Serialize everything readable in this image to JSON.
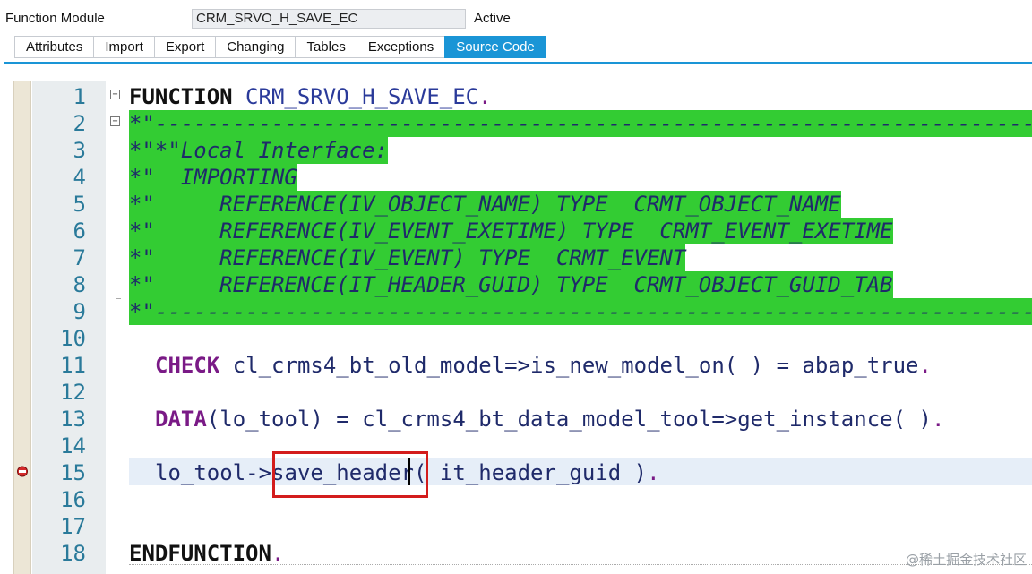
{
  "header": {
    "label": "Function Module",
    "value": "CRM_SRVO_H_SAVE_EC",
    "status": "Active"
  },
  "tabs": [
    {
      "label": "Attributes"
    },
    {
      "label": "Import"
    },
    {
      "label": "Export"
    },
    {
      "label": "Changing"
    },
    {
      "label": "Tables"
    },
    {
      "label": "Exceptions"
    },
    {
      "label": "Source Code",
      "active": true
    }
  ],
  "editor": {
    "line_numbers": [
      "1",
      "2",
      "3",
      "4",
      "5",
      "6",
      "7",
      "8",
      "9",
      "10",
      "11",
      "12",
      "13",
      "14",
      "15",
      "16",
      "17",
      "18"
    ],
    "lines": {
      "l1_kw": "FUNCTION",
      "l1_name": " CRM_SRVO_H_SAVE_EC",
      "l1_dot": ".",
      "l2": "*\"----------------------------------------------------------------------",
      "l3": "*\"*\"Local Interface:",
      "l4": "*\"  IMPORTING",
      "l5": "*\"     REFERENCE(IV_OBJECT_NAME) TYPE  CRMT_OBJECT_NAME",
      "l6": "*\"     REFERENCE(IV_EVENT_EXETIME) TYPE  CRMT_EVENT_EXETIME",
      "l7": "*\"     REFERENCE(IV_EVENT) TYPE  CRMT_EVENT",
      "l8": "*\"     REFERENCE(IT_HEADER_GUID) TYPE  CRMT_OBJECT_GUID_TAB",
      "l9": "*\"----------------------------------------------------------------------",
      "l11_kw": "CHECK",
      "l11_rest": " cl_crms4_bt_old_model=>is_new_model_on( ) = abap_true",
      "l11_dot": ".",
      "l13_kw": "DATA",
      "l13_rest": "(lo_tool) = cl_crms4_bt_data_model_tool=>get_instance( )",
      "l13_dot": ".",
      "l15_a": "lo_tool->",
      "l15_b": "save_header",
      "l15_c": "( it_header_guid )",
      "l15_dot": ".",
      "l18_kw": "ENDFUNCTION",
      "l18_dot": "."
    }
  },
  "icons": {
    "breakpoint": "breakpoint-icon",
    "fold": "fold-collapse-icon"
  },
  "colors": {
    "tab_active": "#1a95d6",
    "comment_bg": "#33cc33",
    "keyword": "#7a1a86",
    "highlight_border": "#d31c1c"
  },
  "watermark": "@稀土掘金技术社区"
}
